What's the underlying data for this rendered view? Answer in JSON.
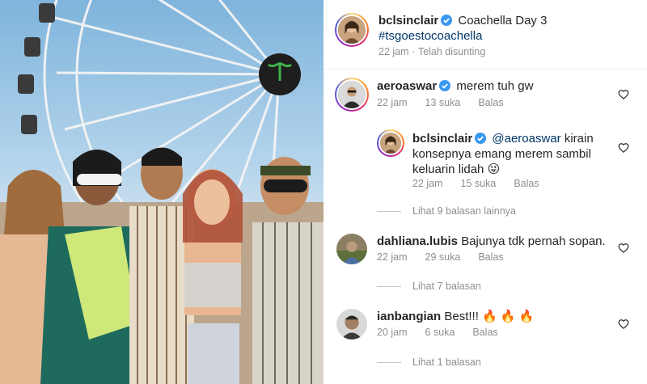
{
  "post": {
    "author": "bclsinclair",
    "caption": "Coachella Day 3",
    "hashtag": "#tsgoestocoachella",
    "time": "22 jam",
    "edited": "· Telah disunting"
  },
  "comments": [
    {
      "username": "aeroaswar",
      "verified": true,
      "text": "merem tuh gw",
      "time": "22 jam",
      "likes": "13 suka",
      "reply_label": "Balas",
      "replies": [
        {
          "username": "bclsinclair",
          "verified": true,
          "mention": "@aeroaswar",
          "text_line1": "kirain",
          "text_line2": "konsepnya emang merem sambil",
          "text_line3": "keluarin lidah",
          "emoji": "😜",
          "time": "22 jam",
          "likes": "15 suka",
          "reply_label": "Balas"
        }
      ],
      "view_more": "Lihat 9 balasan lainnya"
    },
    {
      "username": "dahliana.lubis",
      "verified": false,
      "text": "Bajunya tdk pernah sopan.",
      "time": "22 jam",
      "likes": "29 suka",
      "reply_label": "Balas",
      "view_more": "Lihat 7 balasan"
    },
    {
      "username": "ianbangian",
      "verified": false,
      "text": "Best!!!",
      "emoji": "🔥 🔥 🔥",
      "time": "20 jam",
      "likes": "6 suka",
      "reply_label": "Balas",
      "view_more": "Lihat 1 balasan"
    }
  ],
  "colors": {
    "verified": "#3897f0",
    "link": "#00376b",
    "muted": "#8e8e8e"
  },
  "icons": [
    "verified-badge-icon",
    "heart-icon"
  ]
}
